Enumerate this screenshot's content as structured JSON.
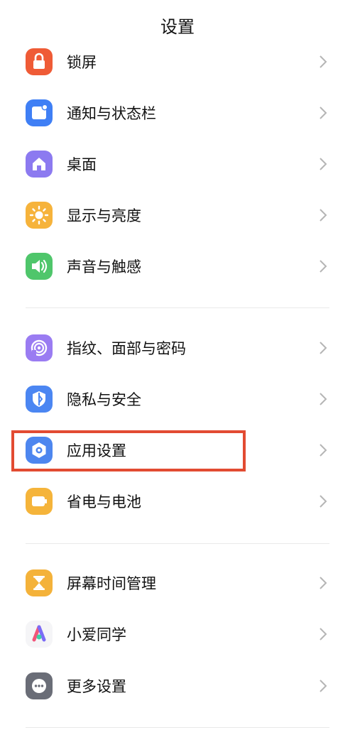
{
  "header": {
    "title": "设置"
  },
  "items": [
    {
      "label": "锁屏",
      "icon": "lock-icon",
      "color": "#ef5b36"
    },
    {
      "label": "通知与状态栏",
      "icon": "notification-icon",
      "color": "#3f7ff5"
    },
    {
      "label": "桌面",
      "icon": "home-icon",
      "color": "#8c7af0"
    },
    {
      "label": "显示与亮度",
      "icon": "sun-icon",
      "color": "#f6b33b"
    },
    {
      "label": "声音与触感",
      "icon": "speaker-icon",
      "color": "#4fc66b"
    },
    {
      "label": "指纹、面部与密码",
      "icon": "fingerprint-icon",
      "color": "#9a7cf2"
    },
    {
      "label": "隐私与安全",
      "icon": "shield-icon",
      "color": "#4b86f2"
    },
    {
      "label": "应用设置",
      "icon": "hexagon-gear-icon",
      "color": "#4d86ef"
    },
    {
      "label": "省电与电池",
      "icon": "battery-icon",
      "color": "#f5b43a"
    },
    {
      "label": "屏幕时间管理",
      "icon": "hourglass-icon",
      "color": "#f4b23a"
    },
    {
      "label": "小爱同学",
      "icon": "xiaoai-icon",
      "color": "#ffffff"
    },
    {
      "label": "更多设置",
      "icon": "more-icon",
      "color": "#6a6d77"
    }
  ],
  "highlight_color": "#e24b32",
  "divider_color": "#e9e9e9"
}
